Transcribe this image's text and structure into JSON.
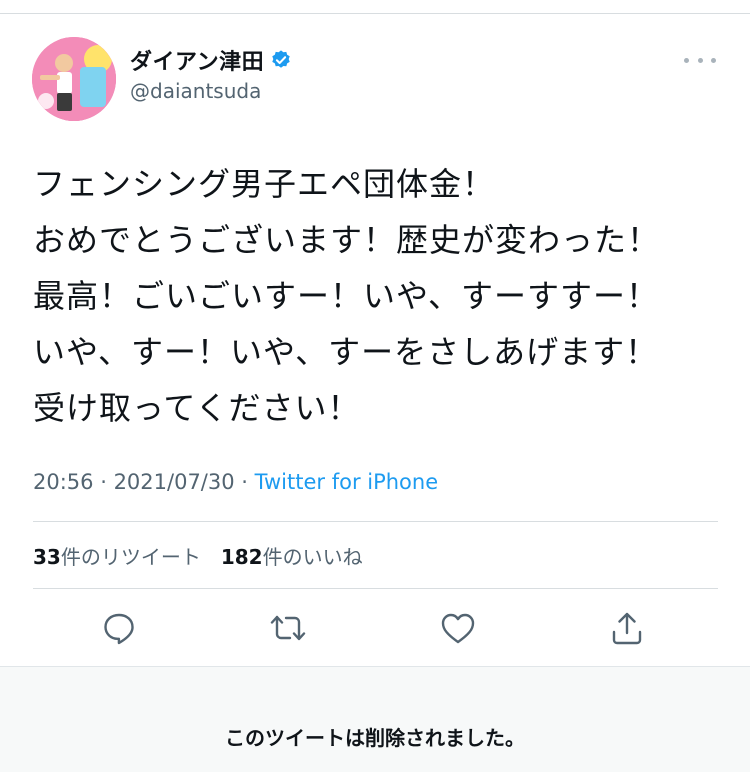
{
  "author": {
    "display_name": "ダイアン津田",
    "handle": "@daiantsuda",
    "verified_icon": "verified-badge-icon",
    "avatar_icon": "avatar-image"
  },
  "tweet": {
    "lines": [
      "フェンシング男子エペ団体金！",
      "おめでとうございます！歴史が変わった！",
      "最高！ごいごいすー！いや、すーすすー！",
      "いや、すー！いや、すーをさしあげます！",
      "受け取ってください！"
    ],
    "time": "20:56",
    "date": "2021/07/30",
    "separator": " · ",
    "source": "Twitter for iPhone"
  },
  "stats": {
    "retweet_count": "33",
    "retweet_label": "件のリツイート",
    "like_count": "182",
    "like_label": "件のいいね"
  },
  "actions": {
    "reply_icon": "reply-icon",
    "retweet_icon": "retweet-icon",
    "like_icon": "like-icon",
    "share_icon": "share-icon"
  },
  "banner": {
    "message": "このツイートは削除されました。"
  },
  "colors": {
    "accent": "#1d9bf0",
    "text": "#0f1419",
    "secondary": "#536471",
    "icon": "#536471",
    "banner_bg": "#f7f9f9"
  }
}
